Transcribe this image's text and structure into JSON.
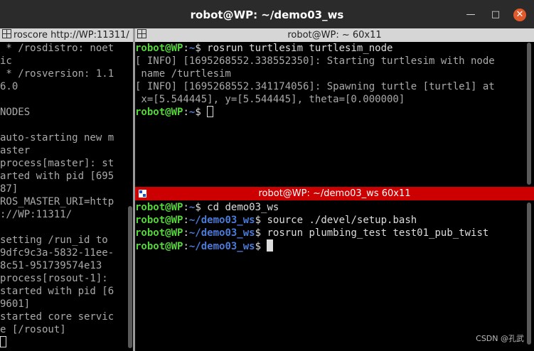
{
  "window": {
    "title": "robot@WP: ~/demo03_ws",
    "minimize_glyph": "—",
    "maximize_glyph": "□",
    "close_glyph": "✕"
  },
  "left_pane": {
    "title": "roscore http://WP:11311/",
    "lines": [
      " * /rosdistro: noet",
      "ic",
      " * /rosversion: 1.1",
      "6.0",
      "",
      "NODES",
      "",
      "auto-starting new m",
      "aster",
      "process[master]: st",
      "arted with pid [695",
      "87]",
      "ROS_MASTER_URI=http",
      "://WP:11311/",
      "",
      "setting /run_id to",
      "9dfc9c3a-5832-11ee-",
      "8c51-951739574e13",
      "process[rosout-1]:",
      "started with pid [6",
      "9601]",
      "started core servic",
      "e [/rosout]"
    ]
  },
  "top_pane": {
    "title": "robot@WP: ~ 60x11",
    "prompt_user": "robot@WP",
    "prompt_path": "~",
    "cmd1": " rosrun turtlesim turtlesim_node",
    "out1": "[ INFO] [1695268552.338552350]: Starting turtlesim with node",
    "out2": " name /turtlesim",
    "out3": "[ INFO] [1695268552.341174056]: Spawning turtle [turtle1] at",
    "out4": " x=[5.544445], y=[5.544445], theta=[0.000000]"
  },
  "bottom_pane": {
    "title": "robot@WP: ~/demo03_ws 60x11",
    "prompt_user": "robot@WP",
    "path_home": "~",
    "path_ws": "~/demo03_ws",
    "cmd1": " cd demo03_ws",
    "cmd2": " source ./devel/setup.bash",
    "cmd3": " rosrun plumbing_test test01_pub_twist"
  },
  "watermark": "CSDN @孔武",
  "colors": {
    "prompt_green": "#55d63a",
    "path_blue": "#4b7ad8",
    "active_header": "#cc0000"
  }
}
